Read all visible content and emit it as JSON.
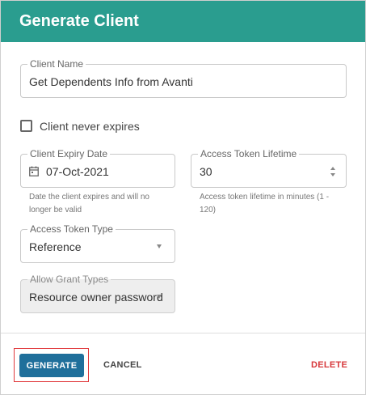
{
  "dialog": {
    "title": "Generate Client"
  },
  "form": {
    "client_name": {
      "label": "Client Name",
      "value": "Get Dependents Info from Avanti"
    },
    "never_expires": {
      "label": "Client never expires",
      "checked": false
    },
    "expiry_date": {
      "label": "Client Expiry Date",
      "value": "07-Oct-2021",
      "helper": [
        "Date the client expires and will no",
        "longer be valid"
      ]
    },
    "token_lifetime": {
      "label": "Access Token Lifetime",
      "value": "30",
      "helper": [
        "Access token lifetime in minutes (1 -",
        "120)"
      ]
    },
    "token_type": {
      "label": "Access Token Type",
      "value": "Reference"
    },
    "grant_types": {
      "label": "Allow Grant Types",
      "value": "Resource owner password"
    }
  },
  "actions": {
    "generate_label": "GENERATE",
    "cancel_label": "CANCEL",
    "delete_label": "DELETE"
  },
  "colors": {
    "header": "#2a9d8f",
    "primary_button": "#1f6f9b",
    "danger": "#d7383b",
    "highlight_outline": "#e0383b"
  }
}
